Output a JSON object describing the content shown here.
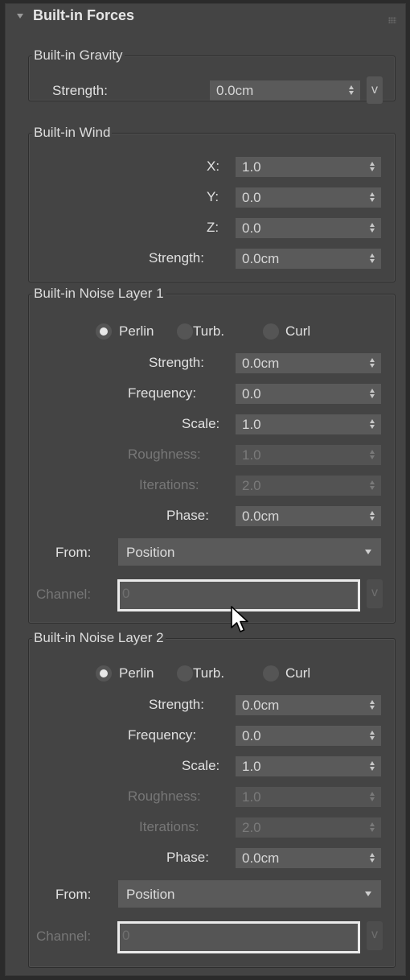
{
  "rollout": {
    "title": "Built-in Forces"
  },
  "gravity": {
    "title": "Built-in Gravity",
    "strength_label": "Strength:",
    "strength_value": "0.0cm",
    "v_label": "v"
  },
  "wind": {
    "title": "Built-in Wind",
    "x_label": "X:",
    "x_value": "1.0",
    "y_label": "Y:",
    "y_value": "0.0",
    "z_label": "Z:",
    "z_value": "0.0",
    "strength_label": "Strength:",
    "strength_value": "0.0cm"
  },
  "noise1": {
    "title": "Built-in Noise Layer 1",
    "radio_perlin": "Perlin",
    "radio_turb": "Turb.",
    "radio_curl": "Curl",
    "selected": "Perlin",
    "strength_label": "Strength:",
    "strength_value": "0.0cm",
    "frequency_label": "Frequency:",
    "frequency_value": "0.0",
    "scale_label": "Scale:",
    "scale_value": "1.0",
    "roughness_label": "Roughness:",
    "roughness_value": "1.0",
    "iterations_label": "Iterations:",
    "iterations_value": "2.0",
    "phase_label": "Phase:",
    "phase_value": "0.0cm",
    "from_label": "From:",
    "from_value": "Position",
    "channel_label": "Channel:",
    "channel_value": "0",
    "v_label": "v"
  },
  "noise2": {
    "title": "Built-in Noise Layer 2",
    "radio_perlin": "Perlin",
    "radio_turb": "Turb.",
    "radio_curl": "Curl",
    "selected": "Perlin",
    "strength_label": "Strength:",
    "strength_value": "0.0cm",
    "frequency_label": "Frequency:",
    "frequency_value": "0.0",
    "scale_label": "Scale:",
    "scale_value": "1.0",
    "roughness_label": "Roughness:",
    "roughness_value": "1.0",
    "iterations_label": "Iterations:",
    "iterations_value": "2.0",
    "phase_label": "Phase:",
    "phase_value": "0.0cm",
    "from_label": "From:",
    "from_value": "Position",
    "channel_label": "Channel:",
    "channel_value": "0",
    "v_label": "v"
  },
  "icons": {
    "collapse": "triangle-down-icon",
    "grip": "grip-dots-icon",
    "spinner": "spinner-arrows-icon",
    "dropdown": "chevron-down-icon",
    "cursor": "mouse-pointer-icon"
  }
}
